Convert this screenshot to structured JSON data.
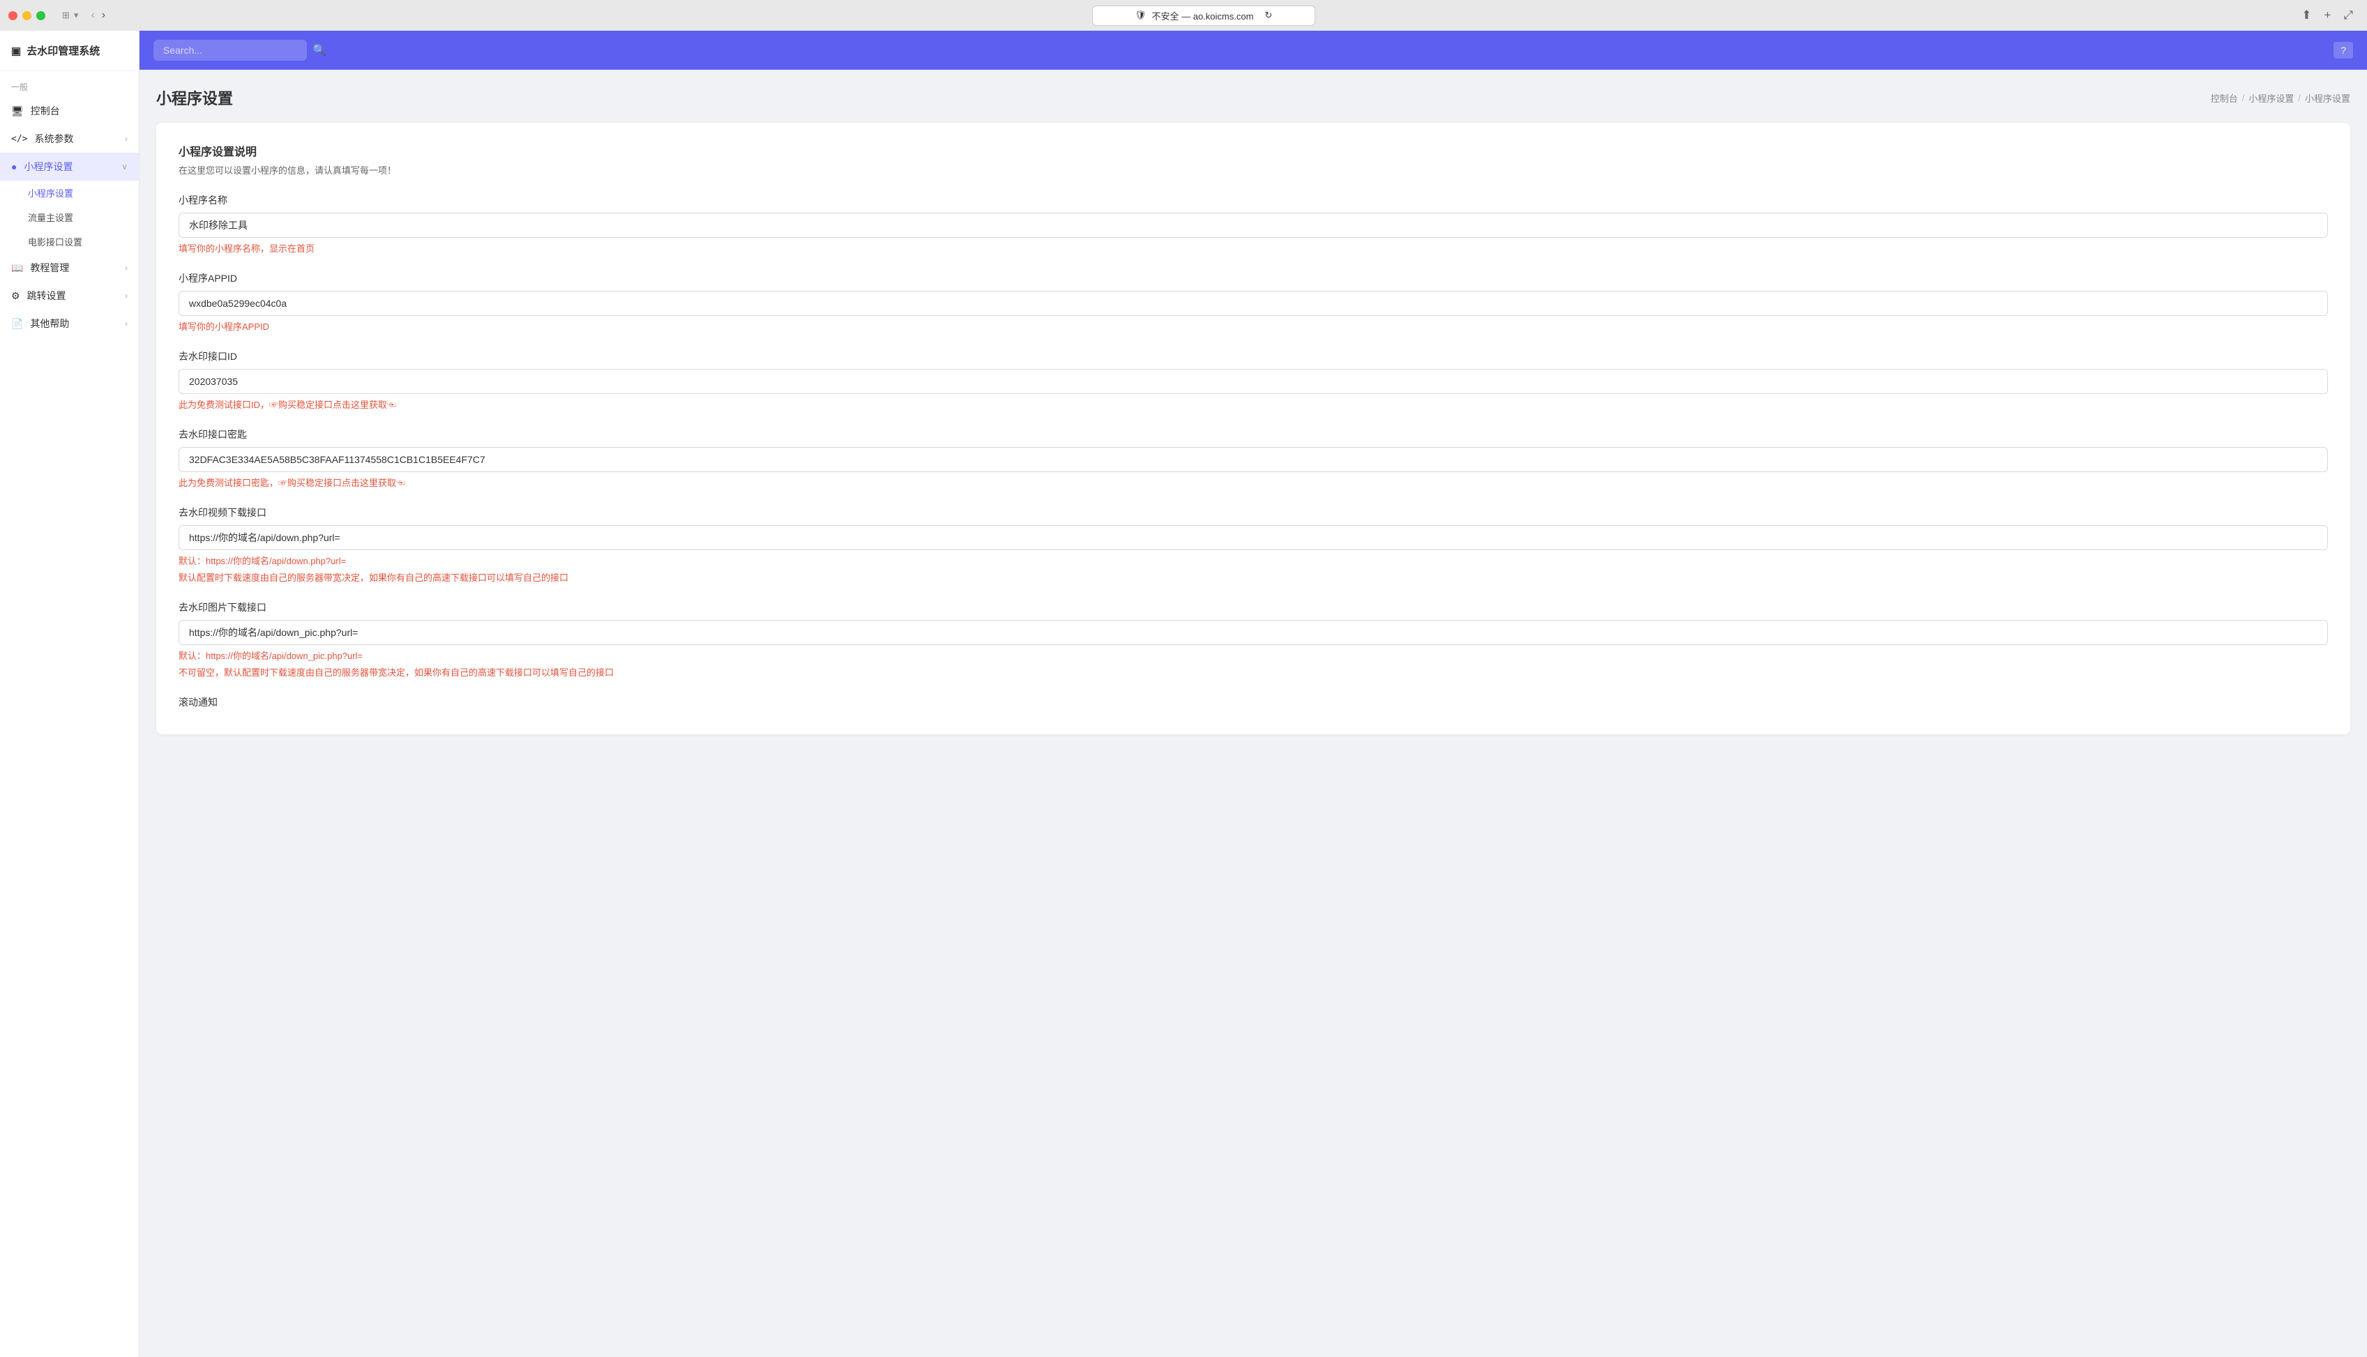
{
  "titlebar": {
    "url_text": "不安全 — ao.koicms.com",
    "shield_icon": "🛡",
    "refresh_icon": "↻"
  },
  "sidebar": {
    "logo": "去水印管理系统",
    "logo_icon": "▣",
    "general_label": "一般",
    "items": [
      {
        "id": "console",
        "label": "控制台",
        "icon": "🖥",
        "active": false,
        "hasChildren": false
      },
      {
        "id": "system-params",
        "label": "系统参数",
        "icon": "</>",
        "active": false,
        "hasChildren": true
      },
      {
        "id": "mini-program",
        "label": "小程序设置",
        "icon": "●",
        "active": true,
        "hasChildren": true,
        "children": [
          {
            "id": "mini-program-settings",
            "label": "小程序设置",
            "active": true
          },
          {
            "id": "traffic-settings",
            "label": "流量主设置",
            "active": false
          },
          {
            "id": "movie-api",
            "label": "电影接口设置",
            "active": false
          }
        ]
      },
      {
        "id": "tutorial",
        "label": "教程管理",
        "icon": "📖",
        "active": false,
        "hasChildren": true
      },
      {
        "id": "redirect",
        "label": "跳转设置",
        "icon": "⚙",
        "active": false,
        "hasChildren": true
      },
      {
        "id": "other-help",
        "label": "其他帮助",
        "icon": "📄",
        "active": false,
        "hasChildren": true
      }
    ]
  },
  "topbar": {
    "search_placeholder": "Search...",
    "help_icon": "?"
  },
  "page": {
    "title": "小程序设置",
    "breadcrumb": [
      "控制台",
      "小程序设置",
      "小程序设置"
    ]
  },
  "form": {
    "section_title": "小程序设置说明",
    "section_desc": "在这里您可以设置小程序的信息，请认真填写每一项！",
    "fields": [
      {
        "id": "app-name",
        "label": "小程序名称",
        "value": "水印移除工具",
        "hint": "填写你的小程序名称，显示在首页",
        "hint_type": "warning"
      },
      {
        "id": "appid",
        "label": "小程序APPID",
        "value": "wxdbe0a5299ec04c0a",
        "hint": "填写你的小程序APPID",
        "hint_type": "warning"
      },
      {
        "id": "api-id",
        "label": "去水印接口ID",
        "value": "202037035",
        "hint": "此为免费测试接口ID，☞购买稳定接口点击这里获取☜",
        "hint_type": "warning"
      },
      {
        "id": "api-key",
        "label": "去水印接口密匙",
        "value": "32DFAC3E334AE5A58B5C38FAAF11374558C1CB1C1B5EE4F7C7",
        "hint": "此为免费测试接口密匙，☞购买稳定接口点击这里获取☜",
        "hint_type": "warning"
      },
      {
        "id": "video-api",
        "label": "去水印视频下载接口",
        "value": "https://你的域名/api/down.php?url=",
        "hint": "默认：https://你的域名/api/down.php?url=",
        "hint2": "默认配置时下载速度由自己的服务器带宽决定，如果你有自己的高速下载接口可以填写自己的接口",
        "hint_type": "warning"
      },
      {
        "id": "image-api",
        "label": "去水印图片下载接口",
        "value": "https://你的域名/api/down_pic.php?url=",
        "hint": "默认：https://你的域名/api/down_pic.php?url=",
        "hint2": "不可留空，默认配置时下载速度由自己的服务器带宽决定，如果你有自己的高速下载接口可以填写自己的接口",
        "hint_type": "warning"
      }
    ],
    "next_section": "滚动通知"
  }
}
